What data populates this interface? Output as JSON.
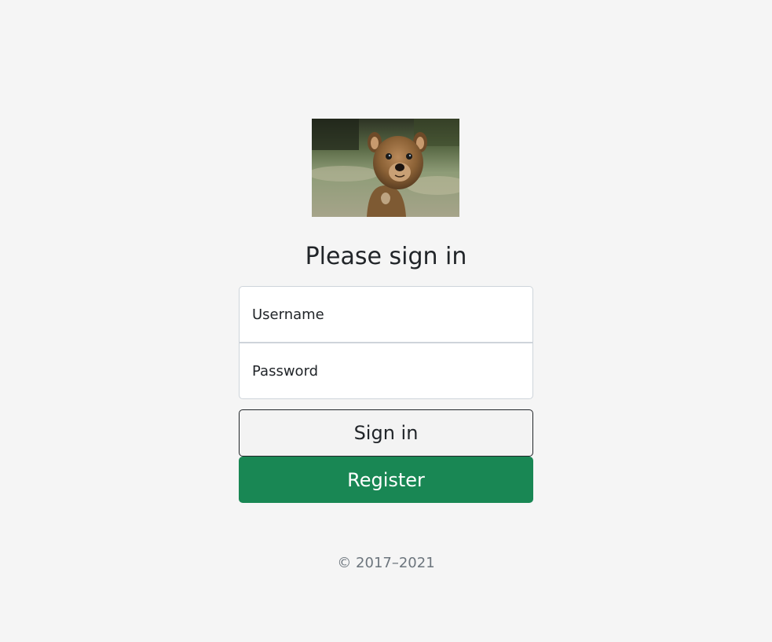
{
  "header": {
    "logo_alt": "quokka-photo",
    "title": "Please sign in"
  },
  "form": {
    "username_placeholder": "Username",
    "password_placeholder": "Password",
    "signin_label": "Sign in",
    "register_label": "Register"
  },
  "footer": {
    "copyright": "© 2017–2021"
  },
  "colors": {
    "background": "#f5f5f5",
    "register_button": "#198754",
    "footer_text": "#6c757d"
  }
}
